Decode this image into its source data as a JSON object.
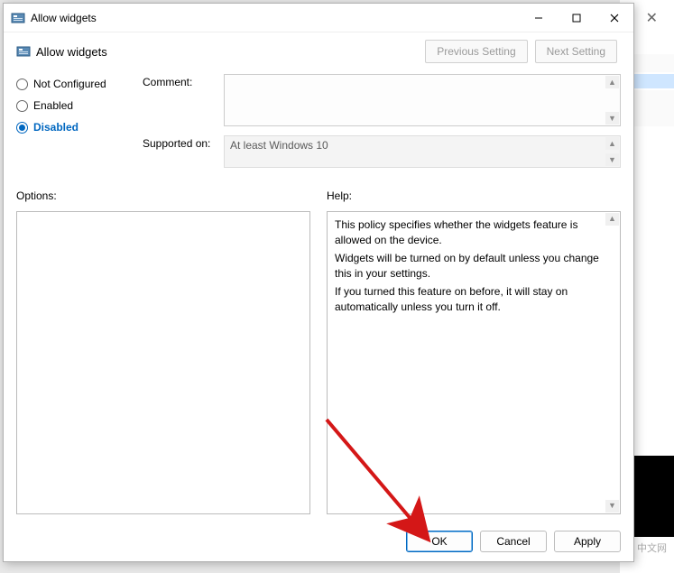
{
  "window": {
    "title": "Allow widgets"
  },
  "header": {
    "policy_name": "Allow widgets",
    "previous_label": "Previous Setting",
    "next_label": "Next Setting"
  },
  "radios": {
    "not_configured": "Not Configured",
    "enabled": "Enabled",
    "disabled": "Disabled",
    "selected": "disabled"
  },
  "fields": {
    "comment_label": "Comment:",
    "comment_value": "",
    "supported_label": "Supported on:",
    "supported_value": "At least Windows 10"
  },
  "options": {
    "label": "Options:",
    "value": ""
  },
  "help": {
    "label": "Help:",
    "p1": "This policy specifies whether the widgets feature is allowed on the device.",
    "p2": "Widgets will be turned on by default unless you change this in your settings.",
    "p3": "If you turned this feature on before, it will stay on automatically unless you turn it off."
  },
  "buttons": {
    "ok": "OK",
    "cancel": "Cancel",
    "apply": "Apply"
  },
  "watermark": {
    "text": "中文网"
  }
}
